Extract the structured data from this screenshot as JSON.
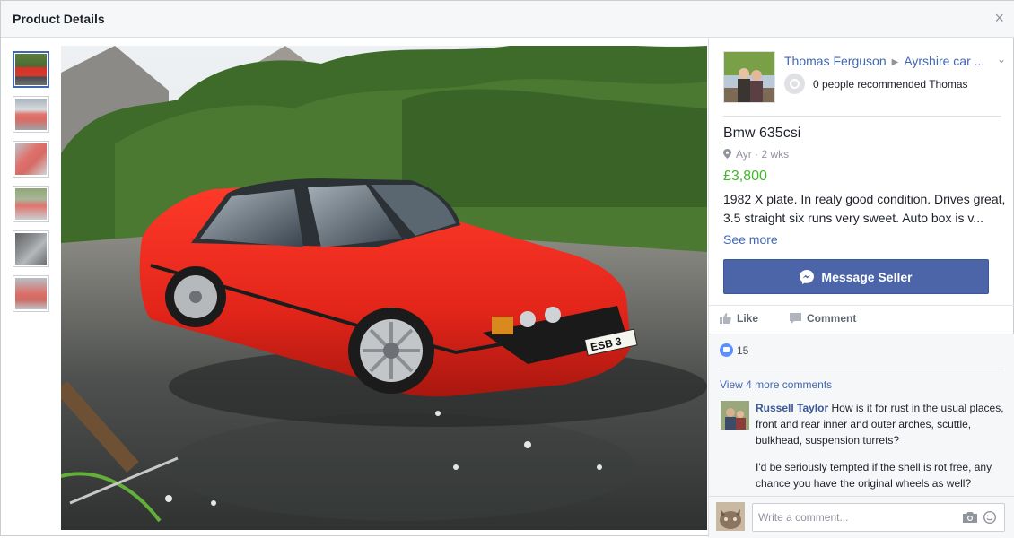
{
  "modal": {
    "title": "Product Details",
    "close_glyph": "×"
  },
  "thumbnails": [
    {
      "name": "thumbnail-1",
      "active": true
    },
    {
      "name": "thumbnail-2",
      "active": false
    },
    {
      "name": "thumbnail-3",
      "active": false
    },
    {
      "name": "thumbnail-4",
      "active": false
    },
    {
      "name": "thumbnail-5",
      "active": false
    },
    {
      "name": "thumbnail-6",
      "active": false
    }
  ],
  "seller": {
    "name": "Thomas Ferguson",
    "group": "Ayrshire car ...",
    "recommendations": "0 people recommended Thomas"
  },
  "product": {
    "title": "Bmw 635csi",
    "location": "Ayr · 2 wks",
    "price": "£3,800",
    "description": "1982 X plate. In realy good condition. Drives great, 3.5 straight six runs very sweet. Auto box is v...",
    "see_more": "See more",
    "message_button": "Message Seller",
    "plate": "ESB 3"
  },
  "actions": {
    "like": "Like",
    "comment": "Comment"
  },
  "comments": {
    "like_count": "15",
    "view_more": "View 4 more comments",
    "items": [
      {
        "author": "Russell Taylor",
        "text": "How is it for rust in the usual places, front and rear inner and outer arches, scuttle, bulkhead, suspension turrets?",
        "text2": "I'd be seriously tempted if the shell is rot free, any chance you have the original wheels as well?"
      }
    ],
    "composer_placeholder": "Write a comment..."
  },
  "colors": {
    "accent": "#4267b2",
    "price": "#42b72a",
    "button": "#4c65a8",
    "car": "#e8281d"
  },
  "icons": [
    "close-icon",
    "chevron-down-icon",
    "recommend-icon",
    "location-pin-icon",
    "messenger-icon",
    "like-icon",
    "comment-icon",
    "like-reaction-icon",
    "camera-icon",
    "emoji-icon"
  ]
}
